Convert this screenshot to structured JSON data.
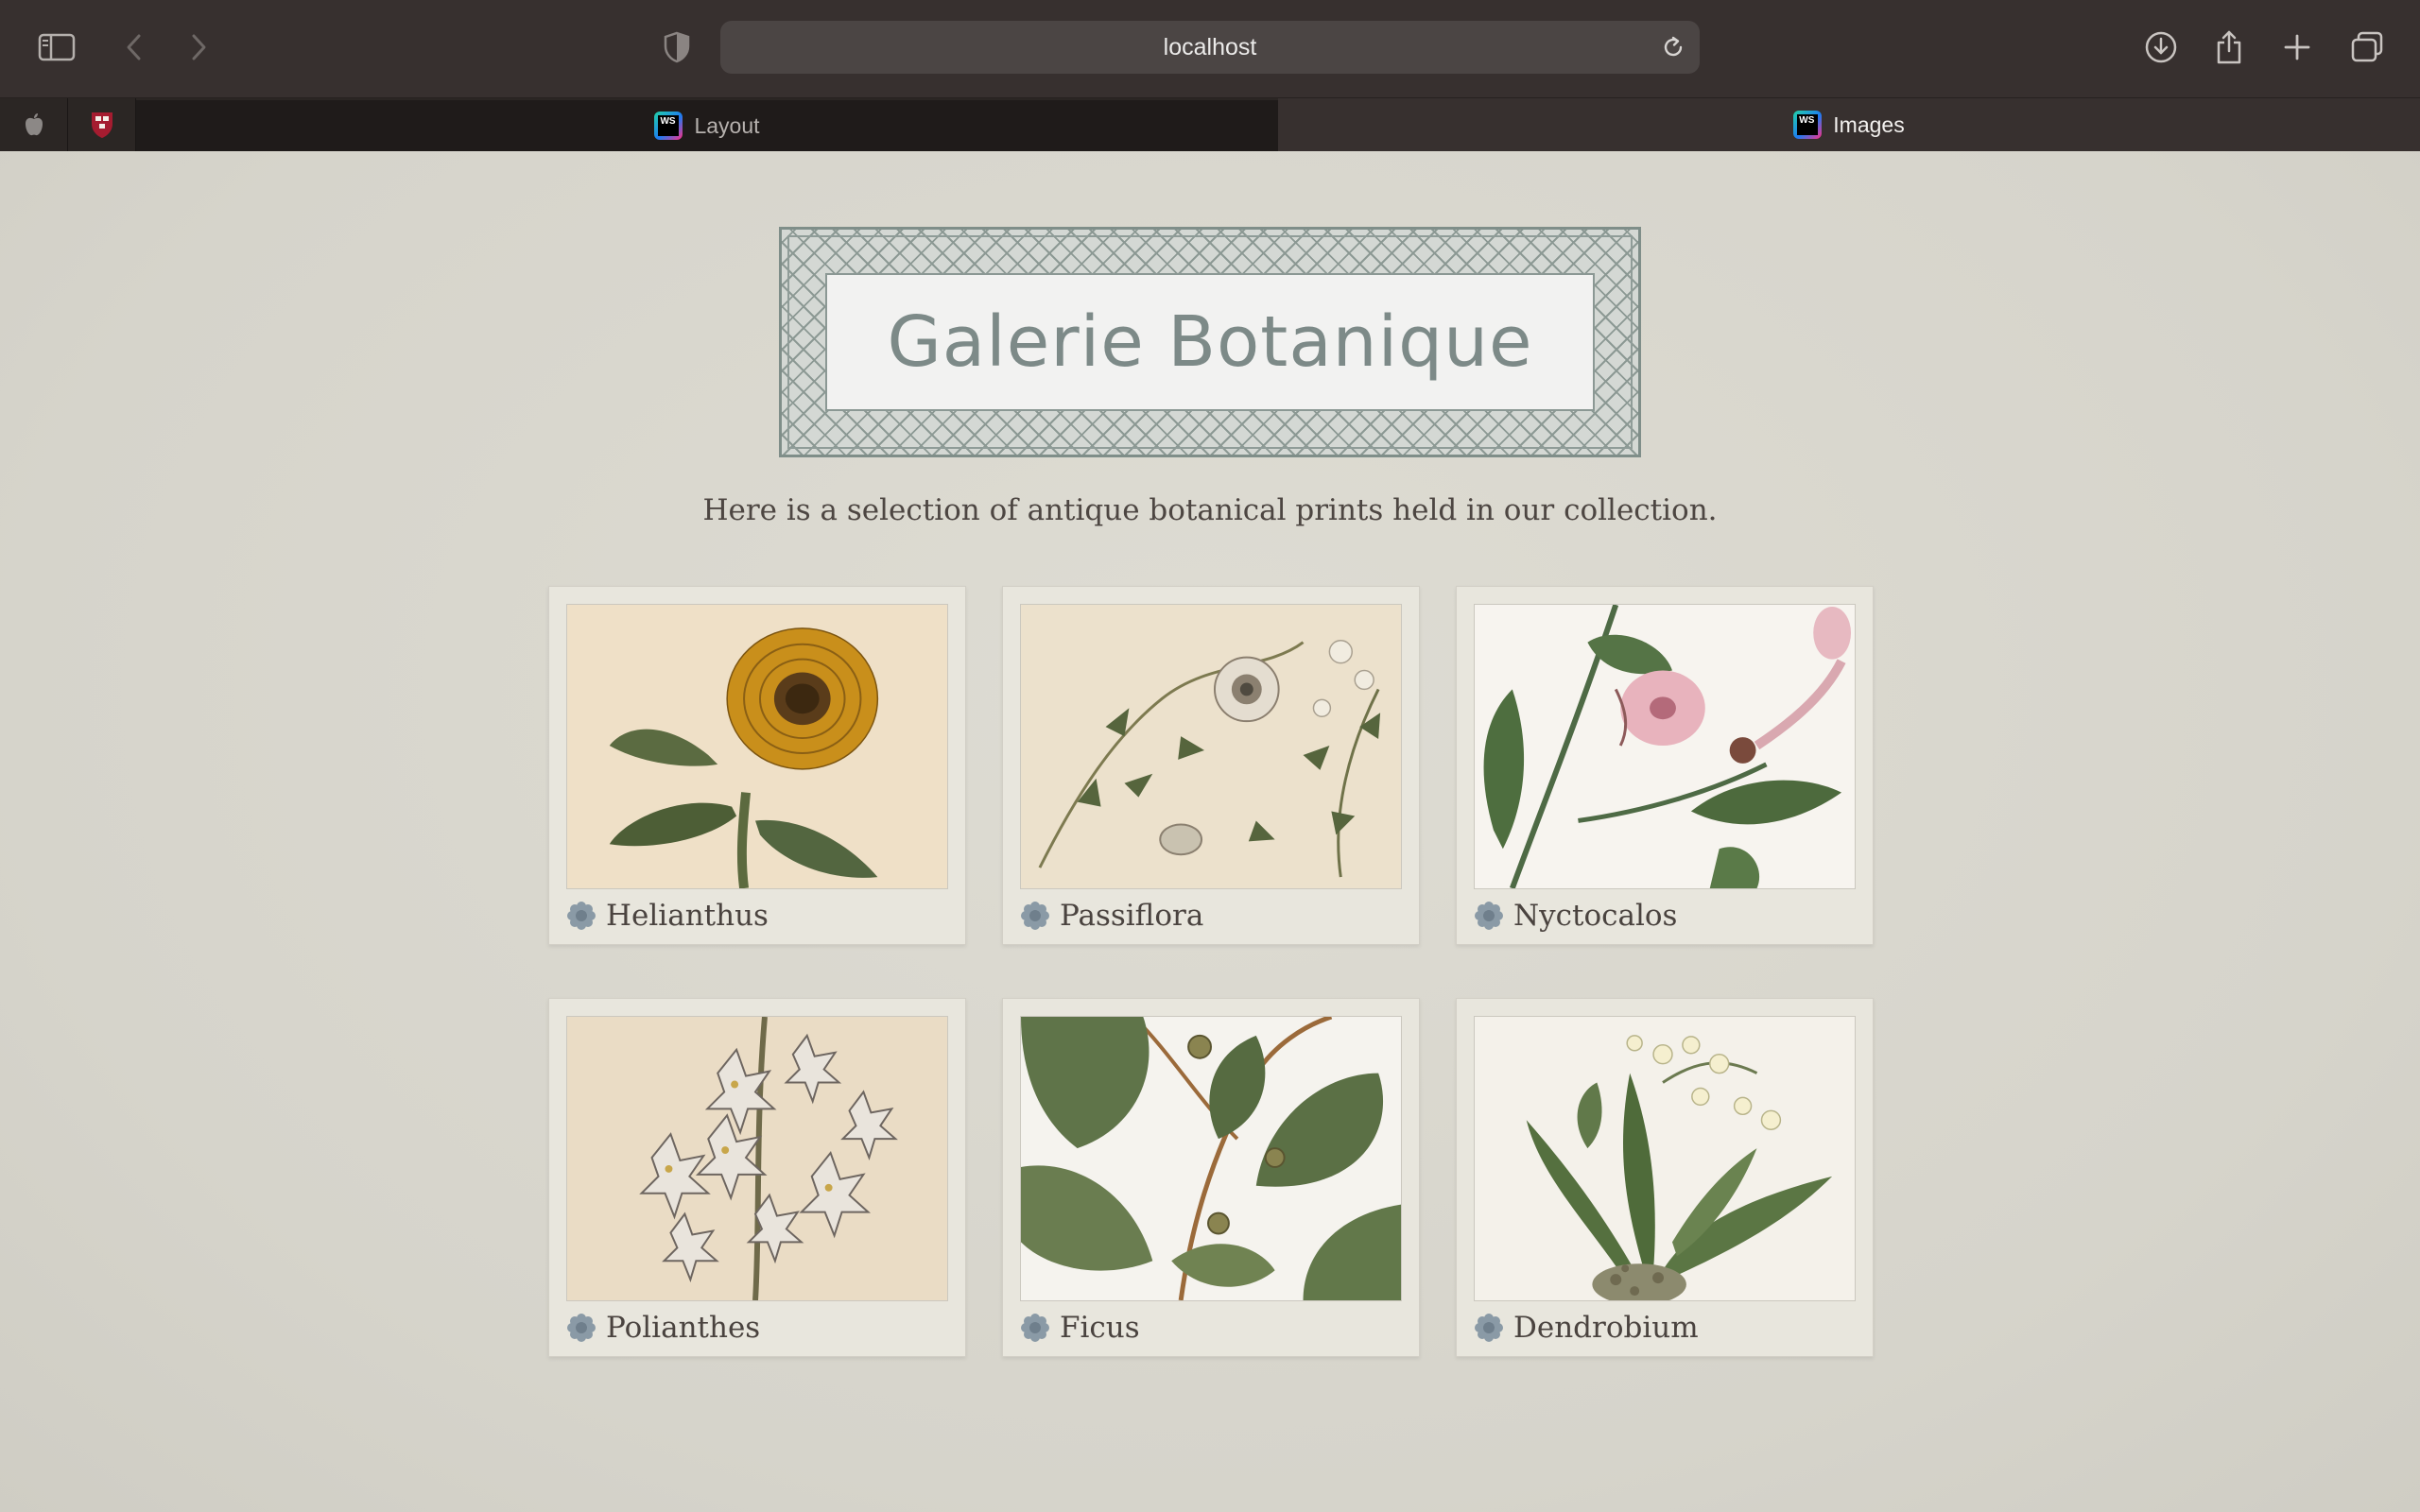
{
  "browser": {
    "address": "localhost",
    "tabs": [
      {
        "label": "Layout",
        "icon": "webstorm-icon",
        "active": false
      },
      {
        "label": "Images",
        "icon": "webstorm-icon",
        "active": true
      }
    ],
    "pinned_tabs": [
      "apple-icon",
      "harvard-shield-icon"
    ]
  },
  "page": {
    "logo_text": "Galerie Botanique",
    "intro": "Here is a selection of antique botanical prints held in our collection.",
    "gallery": [
      {
        "caption": "Helianthus",
        "icon": "flower-icon"
      },
      {
        "caption": "Passiflora",
        "icon": "flower-icon"
      },
      {
        "caption": "Nyctocalos",
        "icon": "flower-icon"
      },
      {
        "caption": "Polianthes",
        "icon": "flower-icon"
      },
      {
        "caption": "Ficus",
        "icon": "flower-icon"
      },
      {
        "caption": "Dendrobium",
        "icon": "flower-icon"
      }
    ]
  },
  "colors": {
    "chrome": "#37302f",
    "page_bg": "#d9d7ce",
    "card_bg": "#e8e6dd",
    "logo_text": "#7d8a88"
  }
}
